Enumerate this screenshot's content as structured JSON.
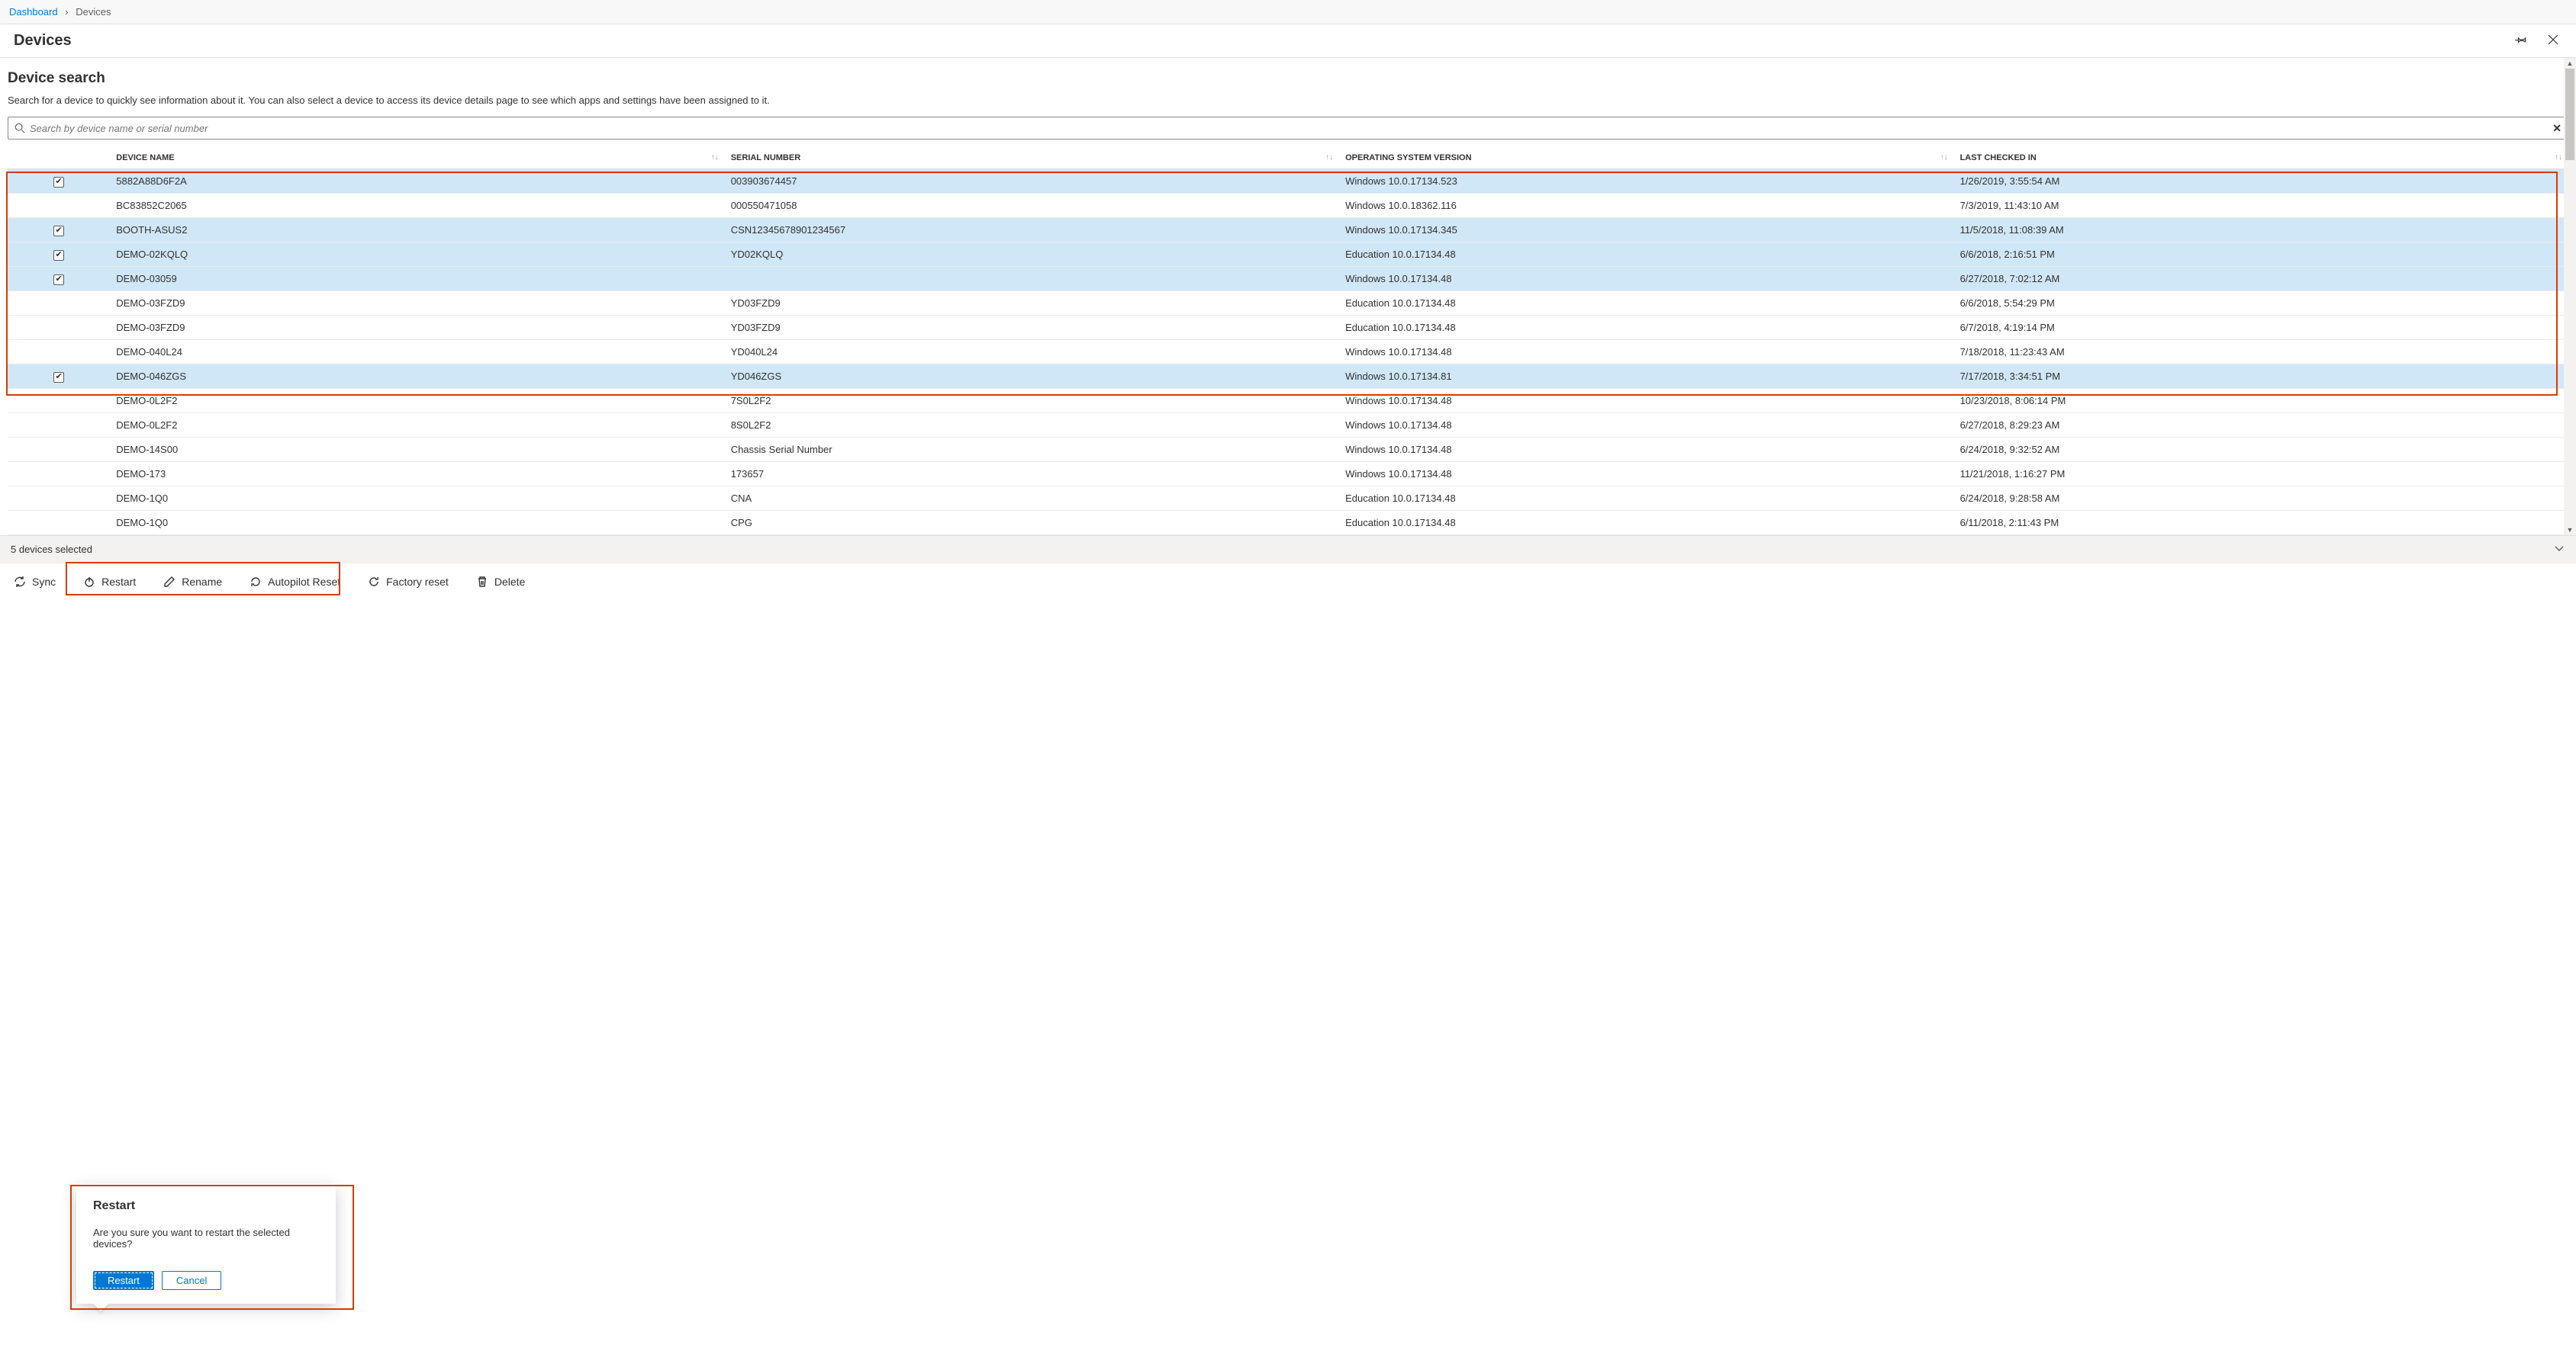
{
  "breadcrumb": {
    "root": "Dashboard",
    "current": "Devices"
  },
  "page_title": "Devices",
  "section": {
    "title": "Device search",
    "description": "Search for a device to quickly see information about it. You can also select a device to access its device details page to see which apps and settings have been assigned to it."
  },
  "search": {
    "placeholder": "Search by device name or serial number"
  },
  "columns": {
    "name": "DEVICE NAME",
    "serial": "SERIAL NUMBER",
    "os": "OPERATING SYSTEM VERSION",
    "checkin": "LAST CHECKED IN"
  },
  "rows": [
    {
      "selected": true,
      "name": "5882A88D6F2A",
      "serial": "003903674457",
      "os": "Windows 10.0.17134.523",
      "checkin": "1/26/2019, 3:55:54 AM"
    },
    {
      "selected": false,
      "name": "BC83852C2065",
      "serial": "000550471058",
      "os": "Windows 10.0.18362.116",
      "checkin": "7/3/2019, 11:43:10 AM"
    },
    {
      "selected": true,
      "name": "BOOTH-ASUS2",
      "serial": "CSN12345678901234567",
      "os": "Windows 10.0.17134.345",
      "checkin": "11/5/2018, 11:08:39 AM"
    },
    {
      "selected": true,
      "name": "DEMO-02KQLQ",
      "serial": "YD02KQLQ",
      "os": "Education 10.0.17134.48",
      "checkin": "6/6/2018, 2:16:51 PM"
    },
    {
      "selected": true,
      "name": "DEMO-03059",
      "serial": "",
      "os": "Windows 10.0.17134.48",
      "checkin": "6/27/2018, 7:02:12 AM"
    },
    {
      "selected": false,
      "name": "DEMO-03FZD9",
      "serial": "YD03FZD9",
      "os": "Education 10.0.17134.48",
      "checkin": "6/6/2018, 5:54:29 PM"
    },
    {
      "selected": false,
      "name": "DEMO-03FZD9",
      "serial": "YD03FZD9",
      "os": "Education 10.0.17134.48",
      "checkin": "6/7/2018, 4:19:14 PM"
    },
    {
      "selected": false,
      "name": "DEMO-040L24",
      "serial": "YD040L24",
      "os": "Windows 10.0.17134.48",
      "checkin": "7/18/2018, 11:23:43 AM"
    },
    {
      "selected": true,
      "name": "DEMO-046ZGS",
      "serial": "YD046ZGS",
      "os": "Windows 10.0.17134.81",
      "checkin": "7/17/2018, 3:34:51 PM"
    },
    {
      "selected": false,
      "name": "DEMO-0L2F2",
      "serial": "7S0L2F2",
      "os": "Windows 10.0.17134.48",
      "checkin": "10/23/2018, 8:06:14 PM"
    },
    {
      "selected": false,
      "name": "DEMO-0L2F2",
      "serial": "8S0L2F2",
      "os": "Windows 10.0.17134.48",
      "checkin": "6/27/2018, 8:29:23 AM"
    },
    {
      "selected": false,
      "name": "DEMO-14S00",
      "serial": "Chassis Serial Number",
      "os": "Windows 10.0.17134.48",
      "checkin": "6/24/2018, 9:32:52 AM"
    },
    {
      "selected": false,
      "name": "DEMO-173",
      "serial": "173657",
      "os": "Windows 10.0.17134.48",
      "checkin": "11/21/2018, 1:16:27 PM"
    },
    {
      "selected": false,
      "name": "DEMO-1Q0",
      "serial": "CNA",
      "os": "Education 10.0.17134.48",
      "checkin": "6/24/2018, 9:28:58 AM"
    },
    {
      "selected": false,
      "name": "DEMO-1Q0",
      "serial": "CPG",
      "os": "Education 10.0.17134.48",
      "checkin": "6/11/2018, 2:11:43 PM"
    }
  ],
  "status": {
    "text": "5 devices selected"
  },
  "actions": {
    "sync": "Sync",
    "restart": "Restart",
    "rename": "Rename",
    "autopilot": "Autopilot Reset",
    "factory": "Factory reset",
    "delete": "Delete"
  },
  "dialog": {
    "title": "Restart",
    "message": "Are you sure you want to restart the selected devices?",
    "confirm": "Restart",
    "cancel": "Cancel"
  }
}
